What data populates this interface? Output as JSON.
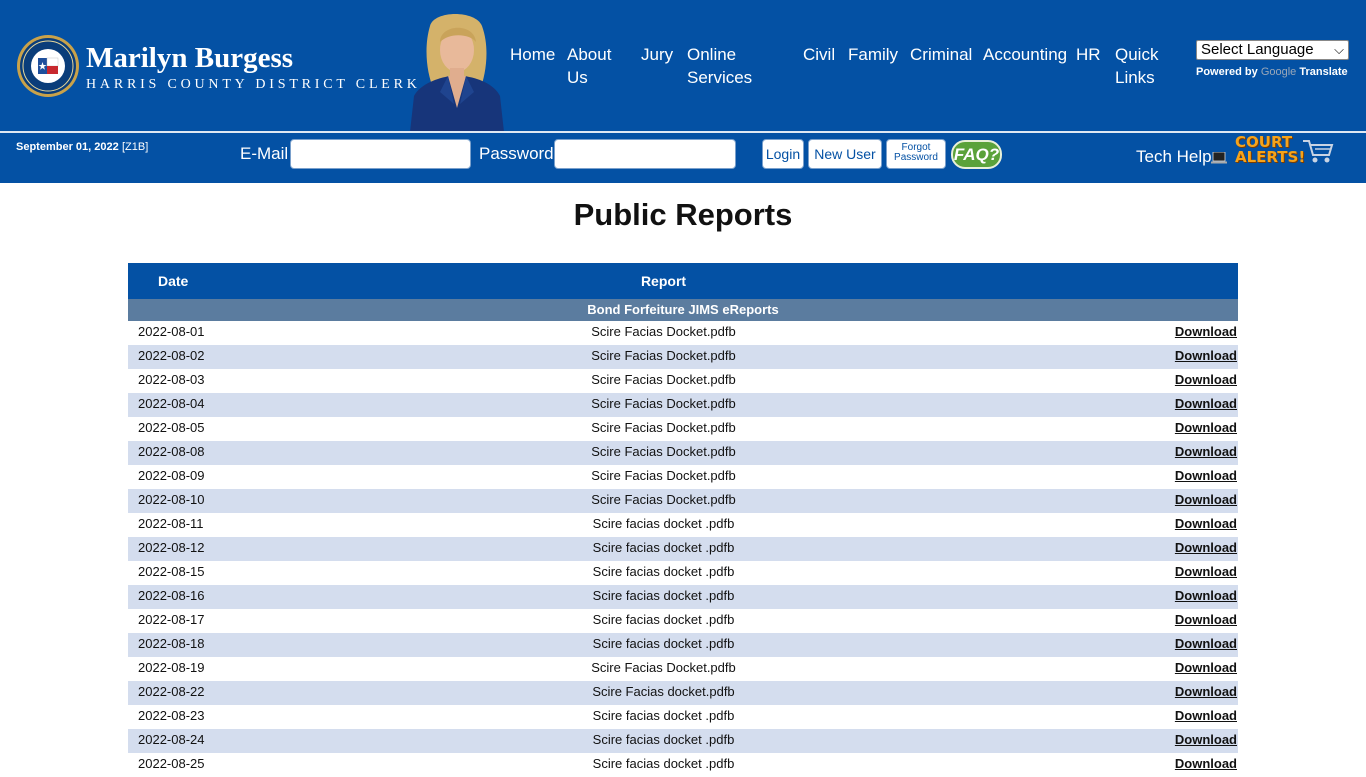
{
  "header": {
    "name": "Marilyn Burgess",
    "subtitle": "HARRIS COUNTY DISTRICT CLERK",
    "nav": [
      {
        "label": "Home"
      },
      {
        "label": "About Us"
      },
      {
        "label": "Jury"
      },
      {
        "label": "Online Services"
      },
      {
        "label": "Civil"
      },
      {
        "label": "Family"
      },
      {
        "label": "Criminal"
      },
      {
        "label": "Accounting"
      },
      {
        "label": "HR"
      },
      {
        "label": "Quick Links"
      }
    ],
    "language_select": "Select Language",
    "powered_by": "Powered by",
    "google": "Google",
    "translate": "Translate"
  },
  "login_bar": {
    "date": "September 01, 2022",
    "zone": "[Z1B]",
    "email_label": "E-Mail",
    "password_label": "Password",
    "login_button": "Login",
    "new_user_button": "New User",
    "forgot_line1": "Forgot",
    "forgot_line2": "Password",
    "faq_button": "FAQ?",
    "tech_help": "Tech Help",
    "alerts_line1": "COURT",
    "alerts_line2": "ALERTS!"
  },
  "page": {
    "title": "Public Reports",
    "table": {
      "col_date": "Date",
      "col_report": "Report",
      "group": "Bond Forfeiture JIMS eReports",
      "download_label": "Download",
      "rows": [
        {
          "date": "2022-08-01",
          "report": "Scire Facias Docket.pdfb"
        },
        {
          "date": "2022-08-02",
          "report": "Scire Facias Docket.pdfb"
        },
        {
          "date": "2022-08-03",
          "report": "Scire Facias Docket.pdfb"
        },
        {
          "date": "2022-08-04",
          "report": "Scire Facias Docket.pdfb"
        },
        {
          "date": "2022-08-05",
          "report": "Scire Facias Docket.pdfb"
        },
        {
          "date": "2022-08-08",
          "report": "Scire Facias Docket.pdfb"
        },
        {
          "date": "2022-08-09",
          "report": "Scire Facias Docket.pdfb"
        },
        {
          "date": "2022-08-10",
          "report": "Scire Facias Docket.pdfb"
        },
        {
          "date": "2022-08-11",
          "report": "Scire facias docket .pdfb"
        },
        {
          "date": "2022-08-12",
          "report": "Scire facias docket .pdfb"
        },
        {
          "date": "2022-08-15",
          "report": "Scire facias docket .pdfb"
        },
        {
          "date": "2022-08-16",
          "report": "Scire facias docket .pdfb"
        },
        {
          "date": "2022-08-17",
          "report": "Scire facias docket .pdfb"
        },
        {
          "date": "2022-08-18",
          "report": "Scire facias docket .pdfb"
        },
        {
          "date": "2022-08-19",
          "report": "Scire Facias Docket.pdfb"
        },
        {
          "date": "2022-08-22",
          "report": "Scire Facias docket.pdfb"
        },
        {
          "date": "2022-08-23",
          "report": "Scire facias docket .pdfb"
        },
        {
          "date": "2022-08-24",
          "report": "Scire facias docket .pdfb"
        },
        {
          "date": "2022-08-25",
          "report": "Scire facias docket .pdfb"
        }
      ]
    }
  },
  "colors": {
    "brand_blue": "#0451a4",
    "row_alt": "#d4ddee",
    "group_bar": "#5b7c9f"
  },
  "icons": [
    "district-clerk-seal-icon",
    "laptop-icon",
    "shopping-cart-icon"
  ]
}
